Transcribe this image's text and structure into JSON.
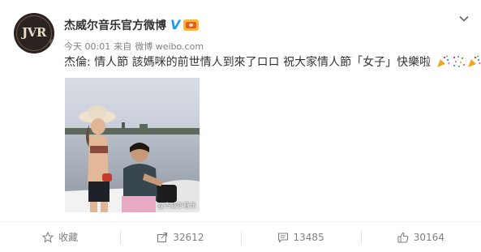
{
  "post": {
    "author": "杰威尔音乐官方微博",
    "verified_mark": "V",
    "meta": {
      "time": "今天 00:01",
      "source_prefix": "来自",
      "source": "微博 weibo.com"
    },
    "text": "杰倫: 情人節 該媽咪的前世情人到來了",
    "text_glyphs": "ロロ",
    "text_tail": " 祝大家情人節「女子」快樂啦",
    "photo_watermark": "@杰威尔音乐",
    "avatar_logo": "JVR",
    "avatar_sub": "music"
  },
  "actions": [
    {
      "label": "收藏",
      "icon": "star-icon"
    },
    {
      "label": "32612",
      "icon": "share-icon"
    },
    {
      "label": "13485",
      "icon": "comment-icon"
    },
    {
      "label": "30164",
      "icon": "like-icon"
    }
  ],
  "colors": {
    "verified": "#1d9bf0",
    "text": "#333333",
    "meta": "#808080",
    "badge": "#f7b733"
  }
}
